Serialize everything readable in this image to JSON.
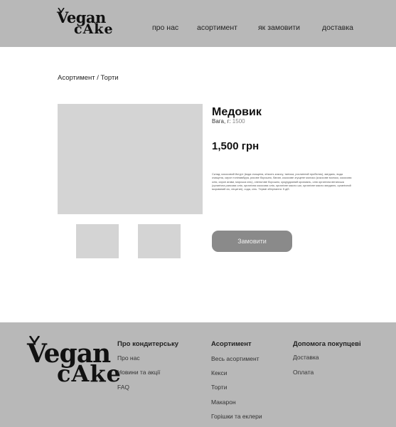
{
  "header": {
    "logo_line1": "Vegan",
    "logo_line2": "cAke",
    "nav": [
      "про нас",
      "асортимент",
      "як замовити",
      "доставка"
    ]
  },
  "breadcrumb": "Асортимент / Торти",
  "product": {
    "name": "Медовик",
    "weight_label": "Вага, г:",
    "weight_value": "1500",
    "price": "1,500 грн",
    "composition": "Склад: кокосовий йогурт (вода очищена, м'якоть кокосу, тапіока, рослинний пробіотик), мигдаль, вода очищена, сироп топінамбура, рисове борошно, банан, кокосове згущене молоко (кокосове молоко, кокосова олія, сироп агави, морська сіль), спельтове борошно, кукурудзяний крохмаль, олія органічна веганська (органічна рапсова олія, органічна кокосова олія, органічне масло ши, органічне масло мигдалю, органічний морквяний сік, лецитин), сода, сіль. Термін зберігання: 5 діб.",
    "order_button": "Замовити"
  },
  "footer": {
    "logo_line1": "Vegan",
    "logo_line2": "cAke",
    "col1": {
      "title": "Про кондитерську",
      "links": [
        "Про нас",
        "Новини та акції",
        "FAQ"
      ]
    },
    "col2": {
      "title": "Асортимент",
      "links": [
        "Весь асортимент",
        "Кекси",
        "Торти",
        "Макарон",
        "Горішки та еклери"
      ]
    },
    "col3": {
      "title": "Допомога покупцеві",
      "links": [
        "Доставка",
        "Оплата"
      ]
    }
  },
  "colors": {
    "header_bg": "#b8b8b8",
    "footer_bg": "#b8b8b8",
    "button_bg": "#8a8a8a",
    "placeholder": "#d4d4d4"
  }
}
